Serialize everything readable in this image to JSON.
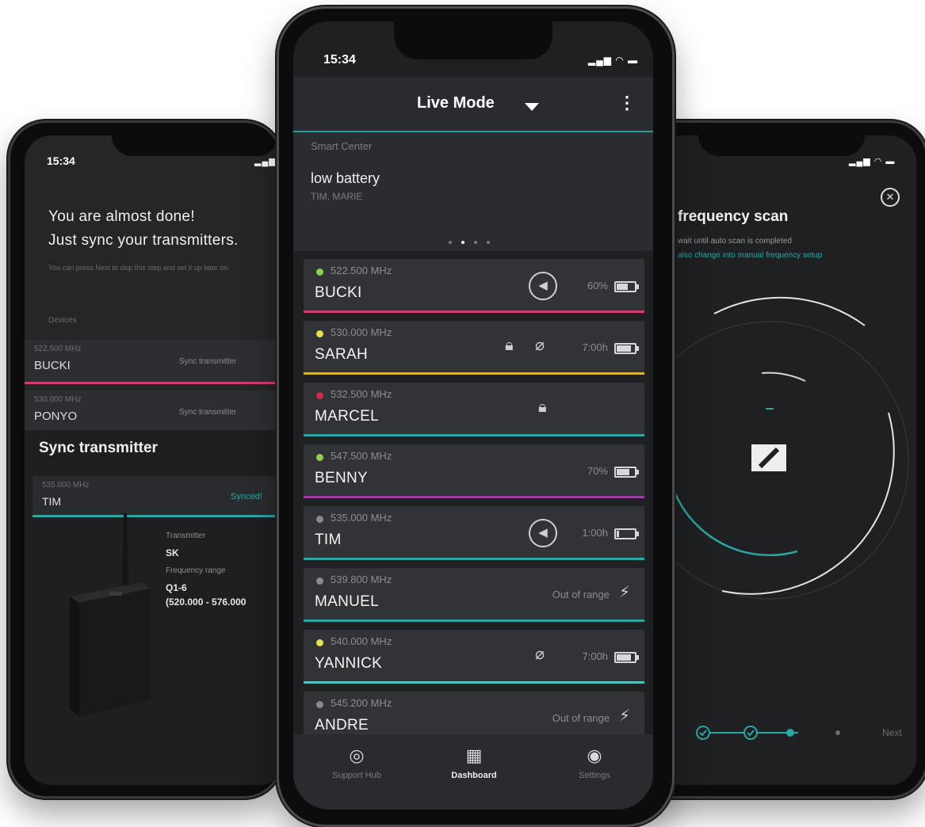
{
  "left_phone": {
    "time": "15:34",
    "title_line1": "You are almost done!",
    "title_line2": "Just sync your transmitters.",
    "hint": "You can press Next to skip this step and set it up later on.",
    "devices_label": "Devices",
    "rows": [
      {
        "freq": "522.500 MHz",
        "name": "BUCKI",
        "action": "Sync transmitter",
        "color": "#d43b6e"
      },
      {
        "freq": "530.000 MHz",
        "name": "PONYO",
        "action": "Sync transmitter",
        "color": "#7a7a7a"
      }
    ],
    "sheet_title": "Sync transmitter",
    "sheet_freq": "535.000 MHz",
    "sheet_name": "TIM",
    "sheet_status": "Synced!",
    "transmitter_label": "Transmitter",
    "transmitter_value": "SK",
    "range_label": "Frequency range",
    "range_value": "Q1-6",
    "range_detail": "(520.000 - 576.000"
  },
  "center_phone": {
    "time": "15:34",
    "header_title": "Live Mode",
    "smart_center": {
      "label": "Smart Center",
      "alert": "low battery",
      "names": "TIM, MARIE",
      "pages": 4,
      "active_page": 1
    },
    "channels": [
      {
        "freq": "522.500 MHz",
        "name": "BUCKI",
        "led": "#8fd14f",
        "icons": [
          "mute-icon"
        ],
        "status": "60%",
        "battery": 0.6,
        "bar": "#d43b6e"
      },
      {
        "freq": "530.000 MHz",
        "name": "SARAH",
        "led": "#e6e04a",
        "icons": [
          "lock-icon",
          "mic-off-icon"
        ],
        "status": "7:00h",
        "battery": 0.8,
        "bar": "#d6b43a"
      },
      {
        "freq": "532.500 MHz",
        "name": "MARCEL",
        "led": "#d4264d",
        "icons": [
          "lock-icon"
        ],
        "status": "",
        "battery": null,
        "bar": "#2aa7a3"
      },
      {
        "freq": "547.500 MHz",
        "name": "BENNY",
        "led": "#8fd14f",
        "icons": [],
        "status": "70%",
        "battery": 0.7,
        "bar": "#9b3fa6"
      },
      {
        "freq": "535.000 MHz",
        "name": "TIM",
        "led": "#8a8a8a",
        "icons": [
          "mute-icon"
        ],
        "status": "1:00h",
        "battery": 0.1,
        "bar": "#2aa7a3"
      },
      {
        "freq": "539.800 MHz",
        "name": "MANUEL",
        "led": "#8a8a8a",
        "icons": [
          "out-of-range-icon"
        ],
        "status": "Out of range",
        "battery": null,
        "bar": "#2aa7a3"
      },
      {
        "freq": "540.000 MHz",
        "name": "YANNICK",
        "led": "#e6e04a",
        "icons": [
          "mic-off-icon"
        ],
        "status": "7:00h",
        "battery": 0.8,
        "bar": "#4fbfc0"
      },
      {
        "freq": "545.200 MHz",
        "name": "ANDRE",
        "led": "#8a8a8a",
        "icons": [
          "out-of-range-icon"
        ],
        "status": "Out of range",
        "battery": null,
        "bar": "#2aa7a3"
      }
    ],
    "nav": [
      {
        "label": "Support Hub",
        "icon": "compass-icon",
        "active": false
      },
      {
        "label": "Dashboard",
        "icon": "grid-icon",
        "active": true
      },
      {
        "label": "Settings",
        "icon": "settings-icon",
        "active": false
      }
    ]
  },
  "right_phone": {
    "title": "frequency scan",
    "line1": "wait until auto scan is completed",
    "line2": "also change into manual frequency setup",
    "next_label": "Next",
    "steps": 4,
    "completed_steps": 2,
    "current_step": 3
  }
}
